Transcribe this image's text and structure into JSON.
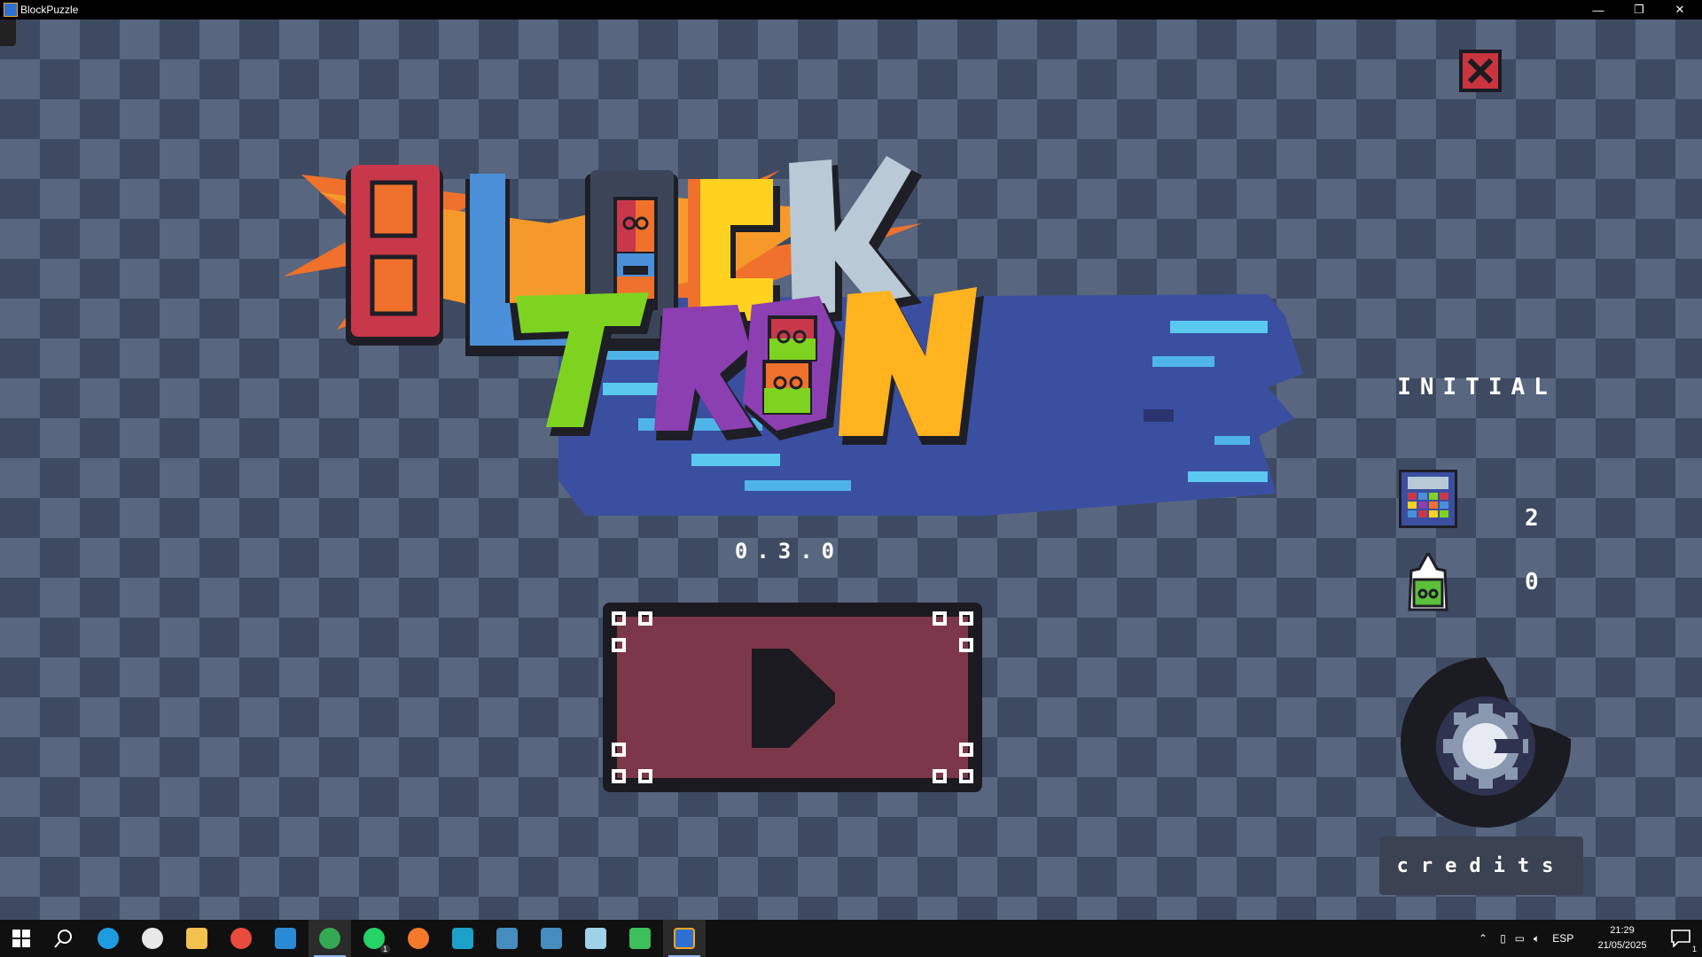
{
  "window": {
    "title": "BlockPuzzle",
    "controls": {
      "minimize": "—",
      "restore": "❐",
      "close": "✕"
    }
  },
  "game": {
    "logo": {
      "line1": "BLOCK",
      "line2": "TRON"
    },
    "version": "0.3.0",
    "status_label": "INITIAL",
    "stats": [
      {
        "icon": "grid-board-icon",
        "value": "2"
      },
      {
        "icon": "green-block-flame-icon",
        "value": "0"
      }
    ],
    "credits_label": "credits",
    "colors": {
      "checker_dark": "#3e4a61",
      "checker_light": "#58667f",
      "play_button": "#7c3848",
      "close_button": "#c9353f"
    }
  },
  "taskbar": {
    "apps": [
      {
        "name": "start",
        "color": "#ffffff"
      },
      {
        "name": "search",
        "color": "#ffffff"
      },
      {
        "name": "edge",
        "color": "#1f9be0"
      },
      {
        "name": "paint-brush",
        "color": "#e8e8e8"
      },
      {
        "name": "file-explorer",
        "color": "#f2c14e"
      },
      {
        "name": "red-yellow-app",
        "color": "#e84c3d"
      },
      {
        "name": "vscode",
        "color": "#2a8ad4"
      },
      {
        "name": "chrome",
        "color": "#34a853"
      },
      {
        "name": "whatsapp",
        "color": "#25d366"
      },
      {
        "name": "blender",
        "color": "#f5792a"
      },
      {
        "name": "c-app",
        "color": "#1ba1c9"
      },
      {
        "name": "godot-1",
        "color": "#478cbf"
      },
      {
        "name": "godot-2",
        "color": "#478cbf"
      },
      {
        "name": "notes",
        "color": "#9fd2e8"
      },
      {
        "name": "grid-app",
        "color": "#3cbf5a"
      },
      {
        "name": "blockpuzzle",
        "color": "#2f6fd1"
      }
    ],
    "whatsapp_badge": "1",
    "language": "ESP",
    "time": "21:29",
    "date": "21/05/2025",
    "notification_count": "1"
  }
}
